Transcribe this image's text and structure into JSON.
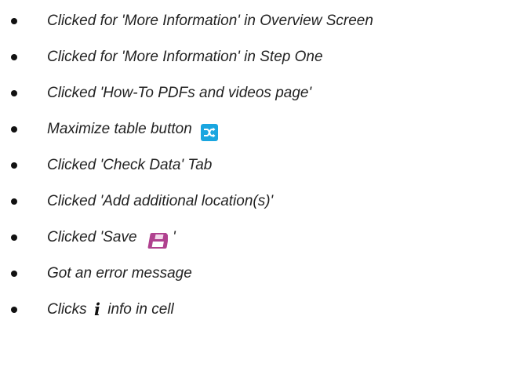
{
  "list": {
    "items": [
      {
        "text": "Clicked for 'More Information' in Overview Screen"
      },
      {
        "text": "Clicked for 'More Information' in Step One"
      },
      {
        "text": "Clicked 'How-To PDFs and videos page'"
      },
      {
        "text": "Maximize table button",
        "icon": "shuffle-icon"
      },
      {
        "text": "Clicked 'Check Data' Tab"
      },
      {
        "text": "Clicked 'Add additional location(s)'"
      },
      {
        "text_before": "Clicked 'Save",
        "icon": "floppy-disk-icon",
        "text_after": "'"
      },
      {
        "text": "Got an error message"
      },
      {
        "text_before": "Clicks",
        "icon": "info-icon",
        "icon_glyph": "i",
        "text_after": "info in cell"
      }
    ]
  },
  "colors": {
    "shuffle_icon_bg": "#1aa6e0",
    "floppy_icon_body": "#b0418f",
    "floppy_icon_label": "#ffffff",
    "text": "#222222"
  }
}
